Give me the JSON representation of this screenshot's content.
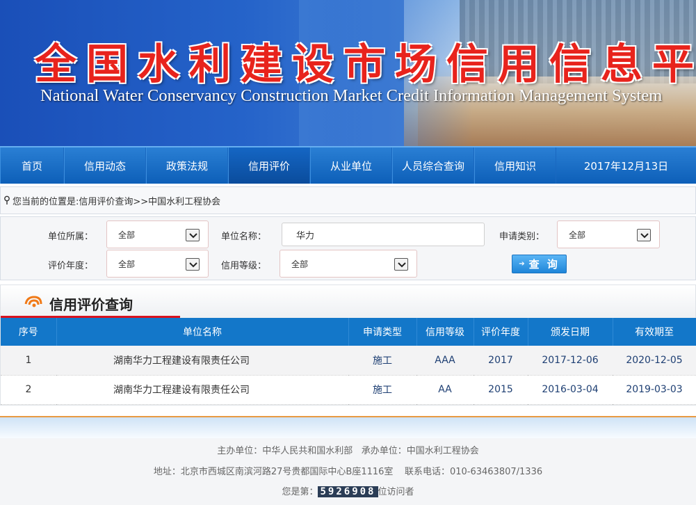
{
  "banner": {
    "title_cn": "全国水利建设市场信用信息平台",
    "title_en": "National Water Conservancy Construction Market Credit Information Management System"
  },
  "nav": {
    "items": [
      {
        "label": "首页"
      },
      {
        "label": "信用动态"
      },
      {
        "label": "政策法规"
      },
      {
        "label": "信用评价",
        "active": true
      },
      {
        "label": "从业单位"
      },
      {
        "label": "人员综合查询"
      },
      {
        "label": "信用知识"
      }
    ],
    "date": "2017年12月13日"
  },
  "breadcrumb": {
    "text": "您当前的位置是:信用评价查询>>中国水利工程协会",
    "icon": "location-pin-icon"
  },
  "form": {
    "unit_affiliation": {
      "label": "单位所属：",
      "value": "全部"
    },
    "unit_name": {
      "label": "单位名称：",
      "value": "华力"
    },
    "apply_type": {
      "label": "申请类别：",
      "value": "全部"
    },
    "eval_year": {
      "label": "评价年度：",
      "value": "全部"
    },
    "credit_level": {
      "label": "信用等级：",
      "value": "全部"
    },
    "search_button": "查 询"
  },
  "section": {
    "title": "信用评价查询"
  },
  "table": {
    "headers": [
      "序号",
      "单位名称",
      "申请类型",
      "信用等级",
      "评价年度",
      "颁发日期",
      "有效期至"
    ],
    "rows": [
      {
        "no": "1",
        "name": "湖南华力工程建设有限责任公司",
        "type": "施工",
        "level": "AAA",
        "year": "2017",
        "issued": "2017-12-06",
        "valid": "2020-12-05"
      },
      {
        "no": "2",
        "name": "湖南华力工程建设有限责任公司",
        "type": "施工",
        "level": "AA",
        "year": "2015",
        "issued": "2016-03-04",
        "valid": "2019-03-03"
      }
    ]
  },
  "footer": {
    "host": "主办单位：中华人民共和国水利部",
    "organizer": "承办单位：中国水利工程协会",
    "address": "地址：北京市西城区南滨河路27号贵都国际中心B座1116室",
    "phone": "联系电话：010-63463807/1336",
    "visitor_prefix": "您是第：",
    "visitor_count": "5926908",
    "visitor_suffix": "位访问者"
  },
  "colors": {
    "nav": "#0d5fb8",
    "table_header": "#1377c9",
    "title_red": "#e8231c",
    "accent_red": "#d9121e"
  }
}
